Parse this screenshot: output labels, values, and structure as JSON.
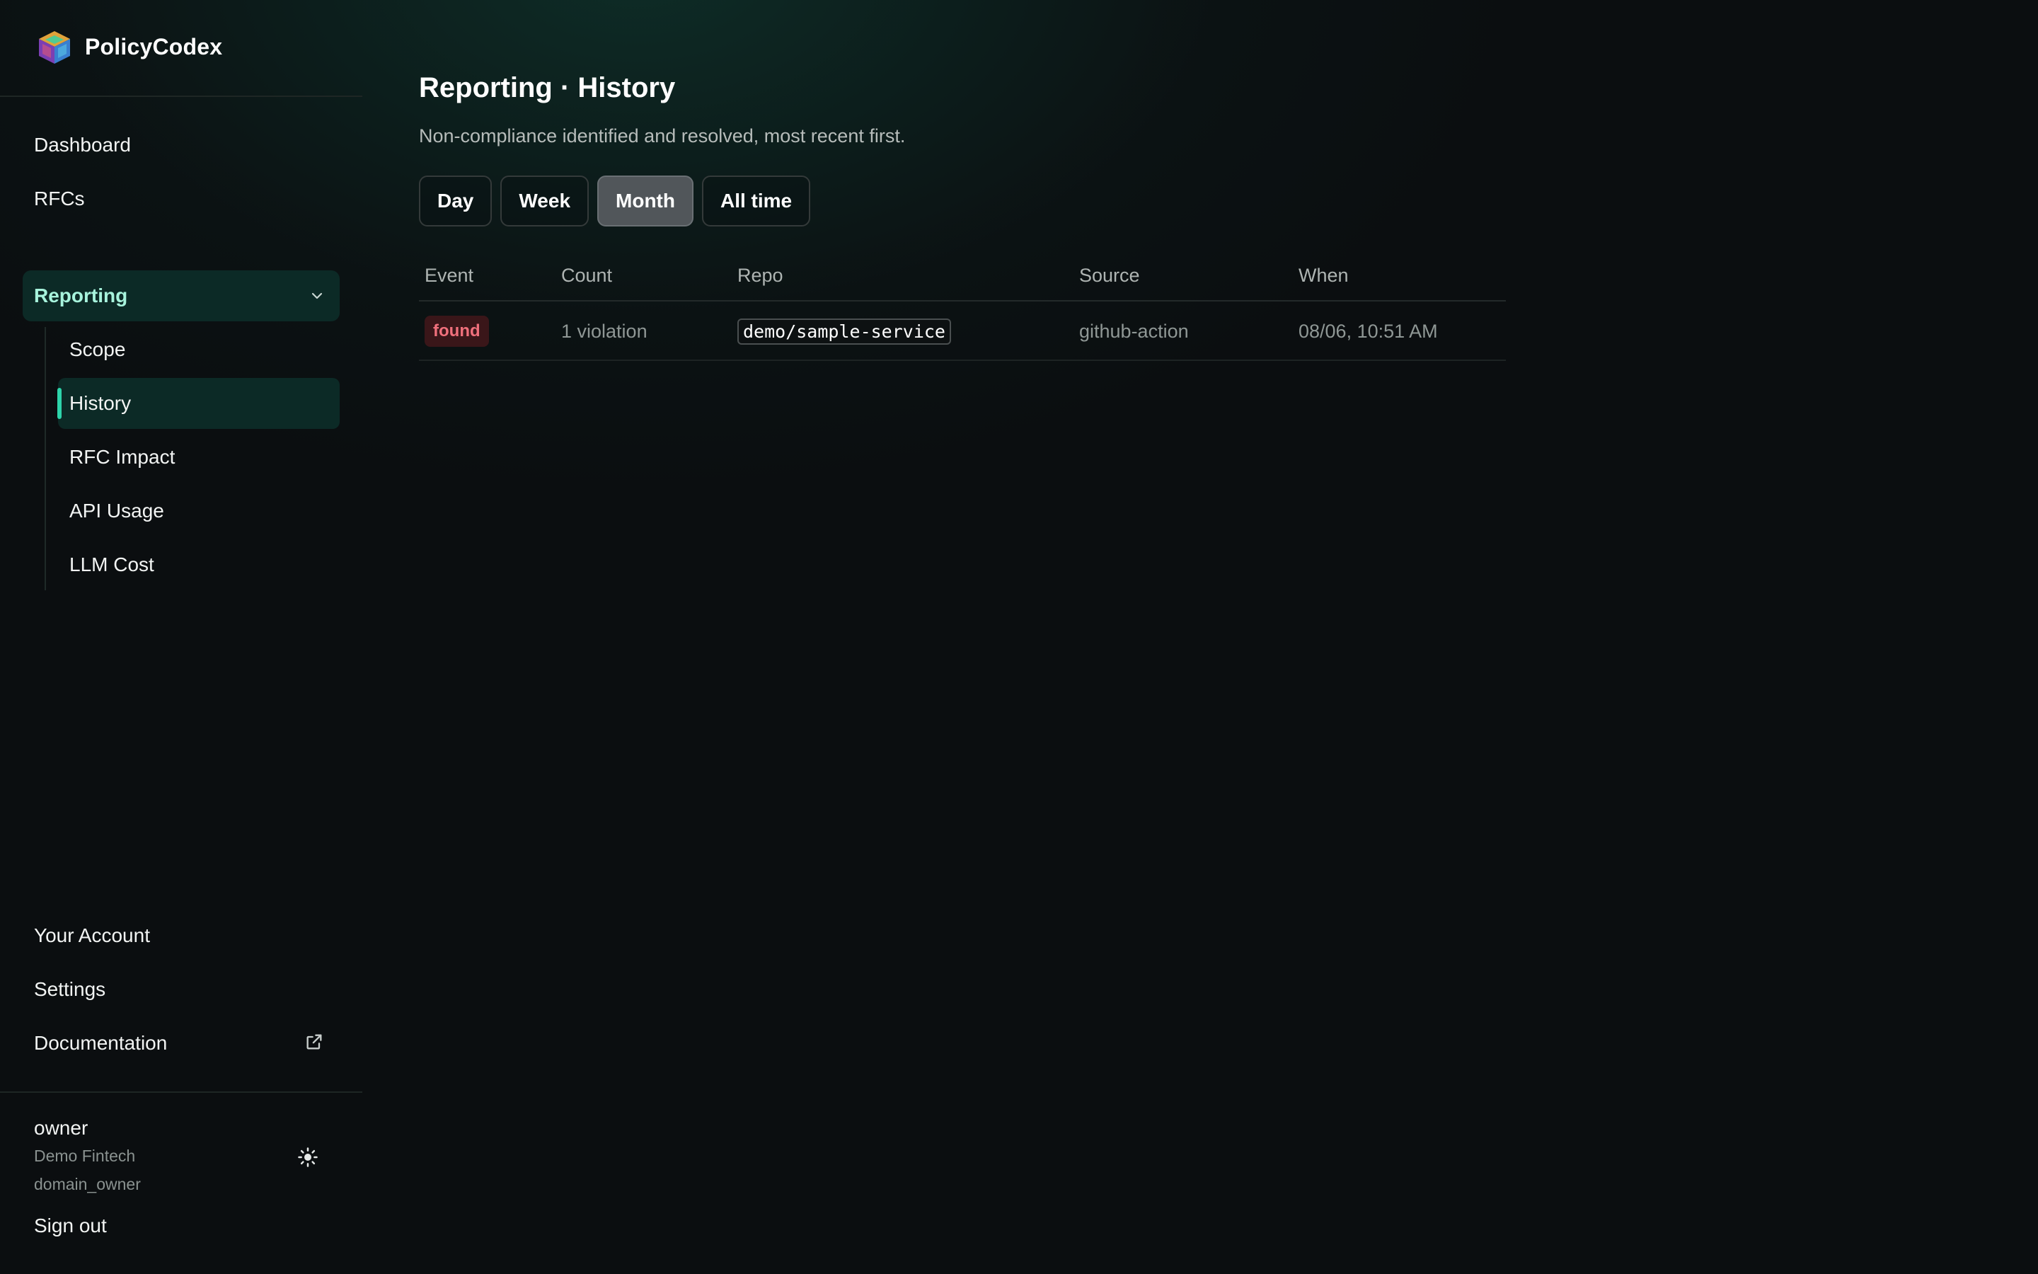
{
  "brand": {
    "name": "PolicyCodex",
    "logo_icon": "cube-logo-icon"
  },
  "nav": {
    "top": [
      {
        "label": "Dashboard"
      },
      {
        "label": "RFCs"
      }
    ],
    "group": {
      "label": "Reporting",
      "expanded": true,
      "items": [
        {
          "label": "Scope",
          "active": false
        },
        {
          "label": "History",
          "active": true
        },
        {
          "label": "RFC Impact",
          "active": false
        },
        {
          "label": "API Usage",
          "active": false
        },
        {
          "label": "LLM Cost",
          "active": false
        }
      ]
    },
    "bottom": [
      {
        "label": "Your Account"
      },
      {
        "label": "Settings"
      },
      {
        "label": "Documentation",
        "external": true
      }
    ]
  },
  "user": {
    "name": "owner",
    "org": "Demo Fintech",
    "role": "domain_owner",
    "sign_out": "Sign out"
  },
  "page": {
    "title": "Reporting · History",
    "subtitle": "Non-compliance identified and resolved, most recent first."
  },
  "filters": {
    "options": [
      "Day",
      "Week",
      "Month",
      "All time"
    ],
    "selected": "Month"
  },
  "table": {
    "columns": [
      "Event",
      "Count",
      "Repo",
      "Source",
      "When"
    ],
    "rows": [
      {
        "event": "found",
        "count": "1 violation",
        "repo": "demo/sample-service",
        "source": "github-action",
        "when": "08/06, 10:51 AM"
      }
    ]
  },
  "colors": {
    "accent": "#2dd4aa",
    "active_bg": "#0c2a26",
    "badge_found_bg": "#3a1619",
    "badge_found_text": "#f0707c"
  }
}
